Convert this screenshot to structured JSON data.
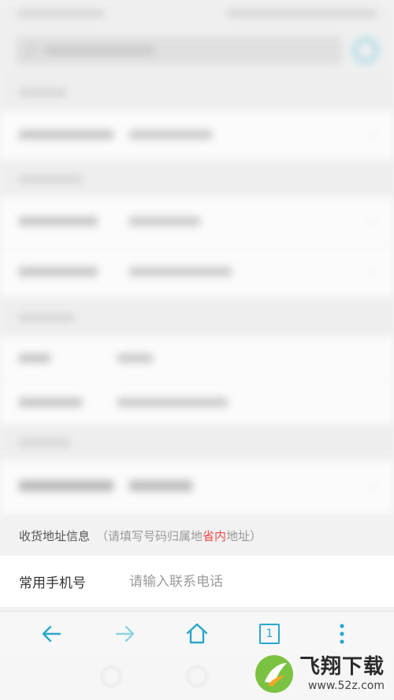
{
  "address_section": {
    "title": "收货地址信息",
    "note_open": "（",
    "note_text": "请填写号码归属地",
    "note_highlight": "省内",
    "note_end": "地址",
    "note_close": "）",
    "highlight_color": "#ef4b4b"
  },
  "phone_field": {
    "label": "常用手机号",
    "placeholder": "请输入联系电话",
    "value": ""
  },
  "browser_toolbar": {
    "tab_count": "1",
    "accent_color": "#2aa7c9"
  },
  "watermark": {
    "title": "飞翔下载",
    "url": "www.52z.com"
  },
  "icons": [
    "back-arrow-icon",
    "forward-arrow-icon",
    "home-icon",
    "tabs-icon",
    "more-icon",
    "logo-mark-icon"
  ]
}
